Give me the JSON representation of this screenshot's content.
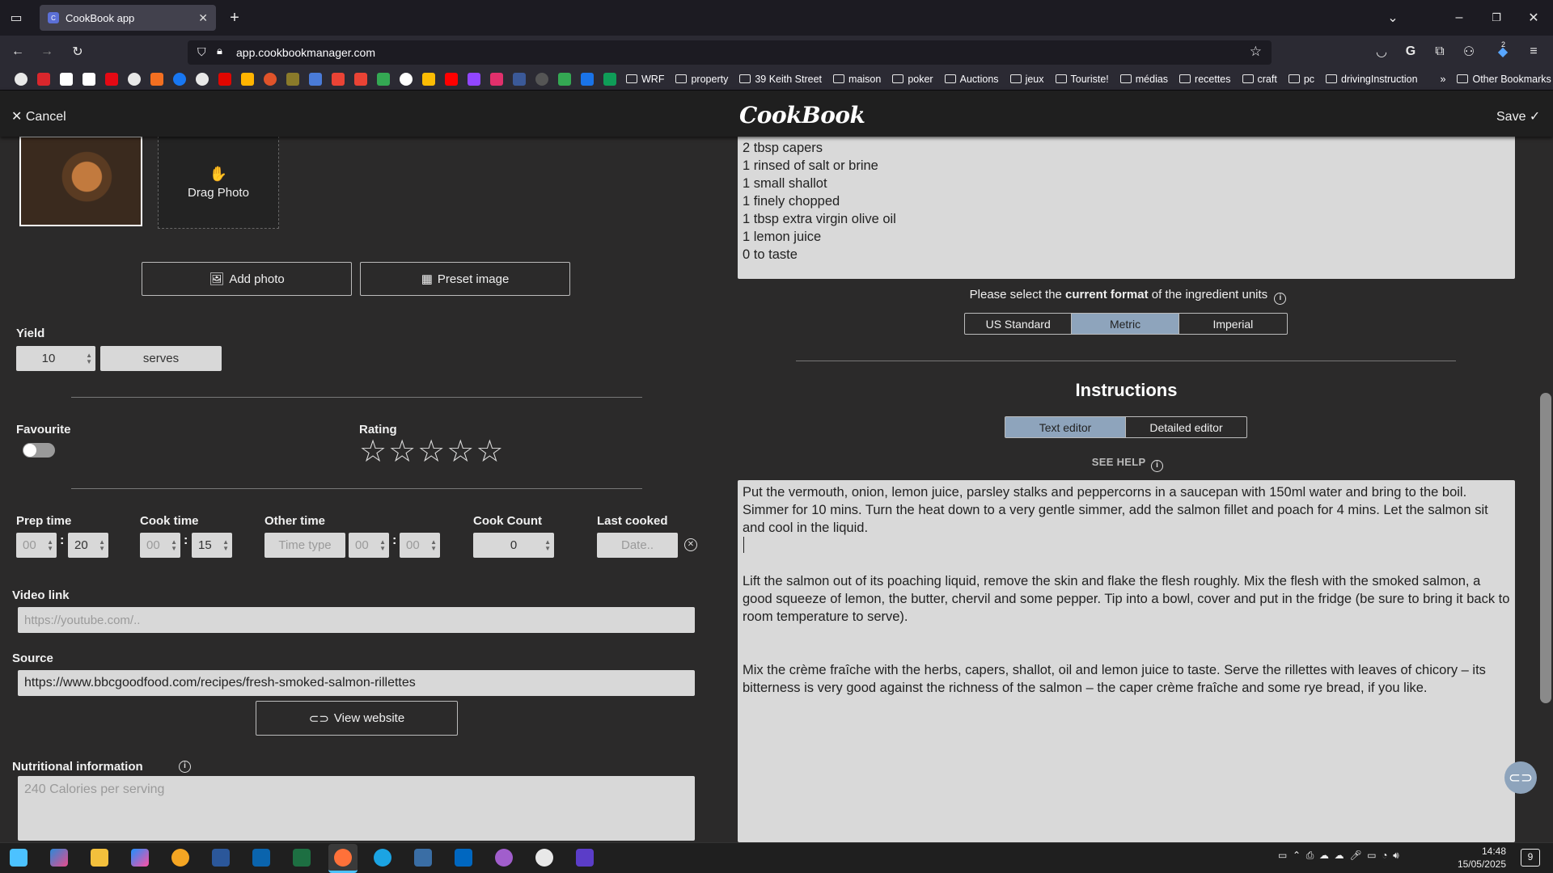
{
  "browser": {
    "tab_title": "CookBook app",
    "url": "app.cookbookmanager.com",
    "bookmarks": [
      "WRF",
      "property",
      "39 Keith Street",
      "maison",
      "poker",
      "Auctions",
      "jeux",
      "Touriste!",
      "médias",
      "recettes",
      "craft",
      "pc",
      "drivingInstruction"
    ],
    "other_bookmarks": "Other Bookmarks",
    "extension_badge": "2"
  },
  "header": {
    "cancel_label": "Cancel",
    "logo": "CookBook",
    "save_label": "Save"
  },
  "photo": {
    "drag_label": "Drag Photo",
    "add_photo_label": "Add photo",
    "preset_image_label": "Preset image"
  },
  "yield": {
    "label": "Yield",
    "value": "10",
    "unit": "serves"
  },
  "favourite": {
    "label": "Favourite"
  },
  "rating": {
    "label": "Rating",
    "value": 0,
    "max": 5
  },
  "times": {
    "prep_label": "Prep time",
    "prep_hours": "00",
    "prep_minutes": "20",
    "cook_label": "Cook time",
    "cook_hours": "00",
    "cook_minutes": "15",
    "other_label": "Other time",
    "other_type_placeholder": "Time type",
    "other_hours": "00",
    "other_minutes": "00",
    "cook_count_label": "Cook Count",
    "cook_count": "0",
    "last_cooked_label": "Last cooked",
    "last_cooked_placeholder": "Date.."
  },
  "video": {
    "label": "Video link",
    "placeholder": "https://youtube.com/.."
  },
  "source": {
    "label": "Source",
    "value": "https://www.bbcgoodfood.com/recipes/fresh-smoked-salmon-rillettes",
    "view_label": "View website"
  },
  "nutrition": {
    "label": "Nutritional information",
    "placeholder": "240 Calories per serving"
  },
  "ingredients": {
    "lines": [
      "2 tbsp capers",
      "1 rinsed of salt or brine",
      "1 small shallot",
      "1 finely chopped",
      "1 tbsp extra virgin olive oil",
      "1 lemon juice",
      "0 to taste"
    ],
    "format_prefix": "Please select the ",
    "format_bold": "current format",
    "format_suffix": " of the ingredient units",
    "formats": [
      "US Standard",
      "Metric",
      "Imperial"
    ],
    "selected_format": "Metric"
  },
  "instructions": {
    "title": "Instructions",
    "modes": [
      "Text editor",
      "Detailed editor"
    ],
    "selected_mode": "Text editor",
    "see_help": "SEE HELP",
    "paragraphs": [
      "Put the vermouth, onion, lemon juice, parsley stalks and peppercorns in a saucepan with 150ml water and bring to the boil. Simmer for 10 mins. Turn the heat down to a very gentle simmer, add the salmon fillet and poach for 4 mins. Let the salmon sit and cool in the liquid.",
      "Lift the salmon out of its poaching liquid, remove the skin and flake the flesh roughly. Mix the flesh with the smoked salmon, a good squeeze of lemon, the butter, chervil and some pepper. Tip into a bowl, cover and put in the fridge (be sure to bring it back to room temperature to serve).",
      "Mix the crème fraîche with the herbs, capers, shallot, oil and lemon juice to taste. Serve the rillettes with leaves of chicory – its bitterness is very good against the richness of the salmon – the caper crème fraîche and some rye bread, if you like."
    ]
  },
  "taskbar": {
    "time": "14:48",
    "date": "15/05/2025",
    "notifications": "9"
  }
}
